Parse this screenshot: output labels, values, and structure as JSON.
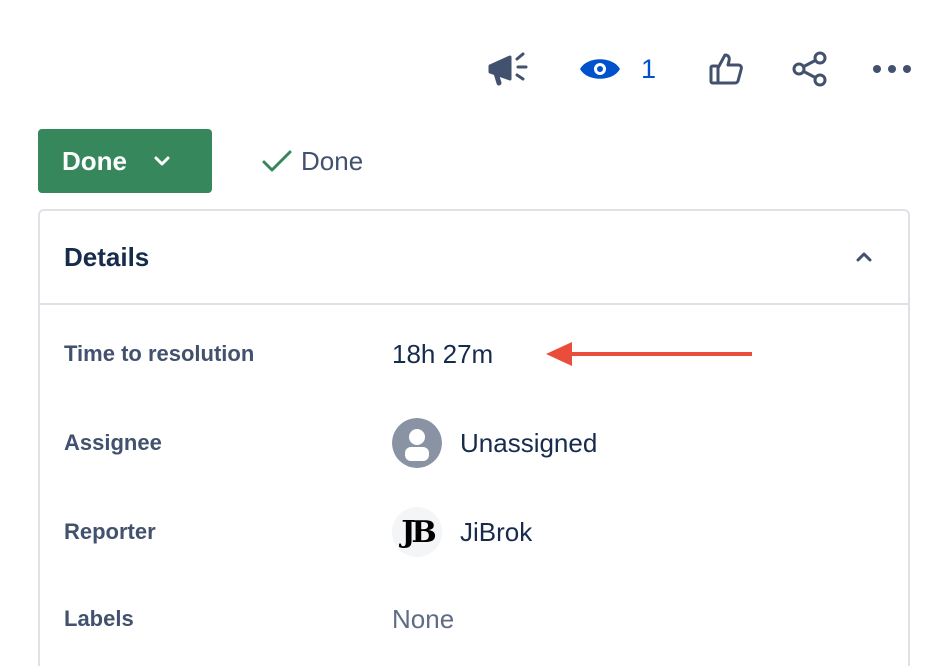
{
  "toolbar": {
    "announce_icon": "megaphone-icon",
    "watch_icon": "eye-icon",
    "watch_count": "1",
    "like_icon": "thumbs-up-icon",
    "share_icon": "share-icon",
    "more_icon": "more-horizontal-icon"
  },
  "status": {
    "label": "Done",
    "resolution": "Done"
  },
  "details": {
    "title": "Details",
    "fields": [
      {
        "label": "Time to resolution",
        "value": "18h 27m"
      },
      {
        "label": "Assignee",
        "value": "Unassigned"
      },
      {
        "label": "Reporter",
        "value": "JiBrok",
        "avatar_text": "JB"
      },
      {
        "label": "Labels",
        "value": "None"
      }
    ]
  },
  "colors": {
    "status_green": "#36875b",
    "watch_blue": "#0052cc",
    "annotation_arrow": "#e94e3c",
    "icon_gray": "#42526e"
  }
}
